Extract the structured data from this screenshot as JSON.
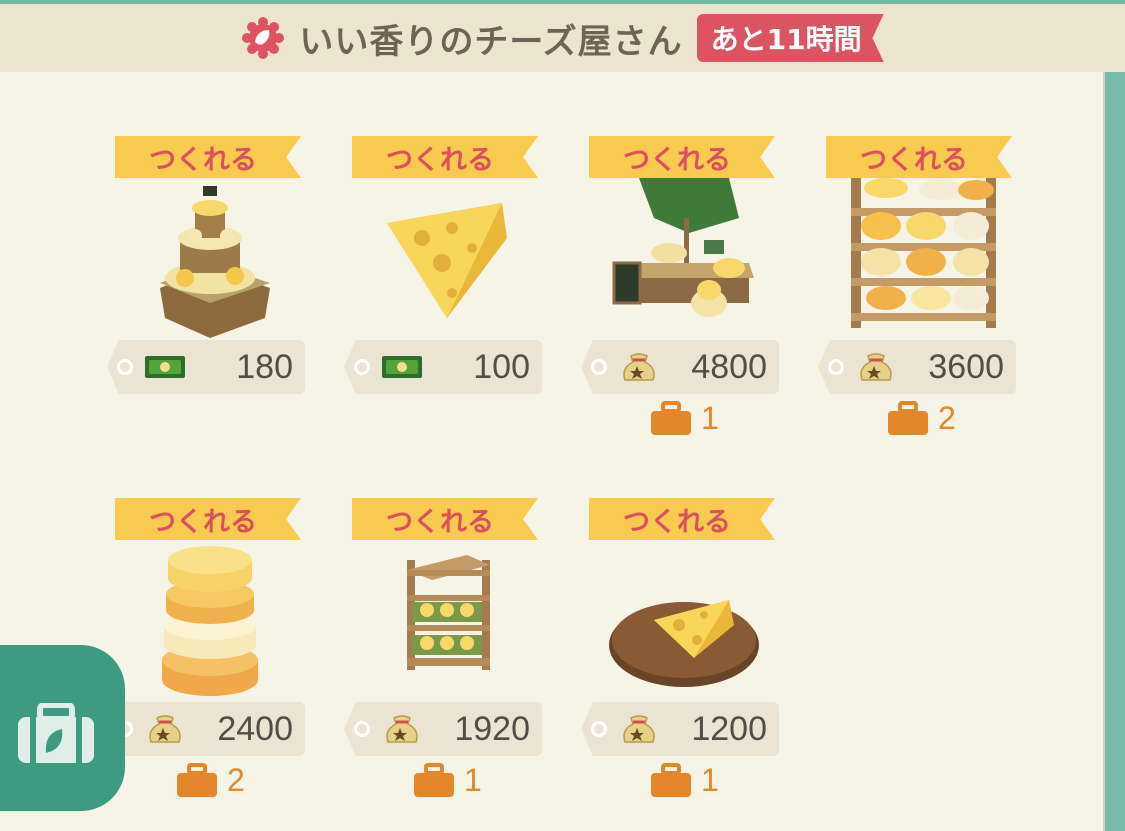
{
  "header": {
    "title": "いい香りのチーズ屋さん",
    "timer": "あと11時間",
    "icon": "flower-icon"
  },
  "items": [
    {
      "badge": "つくれる",
      "name": "cheese-tower-stand",
      "currency": "ticket",
      "price": "180",
      "bag": ""
    },
    {
      "badge": "つくれる",
      "name": "cheese-wedge",
      "currency": "ticket",
      "price": "100",
      "bag": ""
    },
    {
      "badge": "つくれる",
      "name": "cheese-stall",
      "currency": "bells",
      "price": "4800",
      "bag": "1"
    },
    {
      "badge": "つくれる",
      "name": "cheese-shelf",
      "currency": "bells",
      "price": "3600",
      "bag": "2"
    },
    {
      "badge": "つくれる",
      "name": "stacked-cheese-wheels",
      "currency": "bells",
      "price": "2400",
      "bag": "2"
    },
    {
      "badge": "つくれる",
      "name": "cheese-crate-rack",
      "currency": "bells",
      "price": "1920",
      "bag": "1"
    },
    {
      "badge": "つくれる",
      "name": "cheese-on-board",
      "currency": "bells",
      "price": "1200",
      "bag": "1"
    }
  ],
  "colors": {
    "ribbon": "#f8ca4f",
    "ribbon_text": "#dc4f5e",
    "timer": "#dc5463",
    "bag": "#e4862c",
    "accent": "#3e9b82"
  }
}
